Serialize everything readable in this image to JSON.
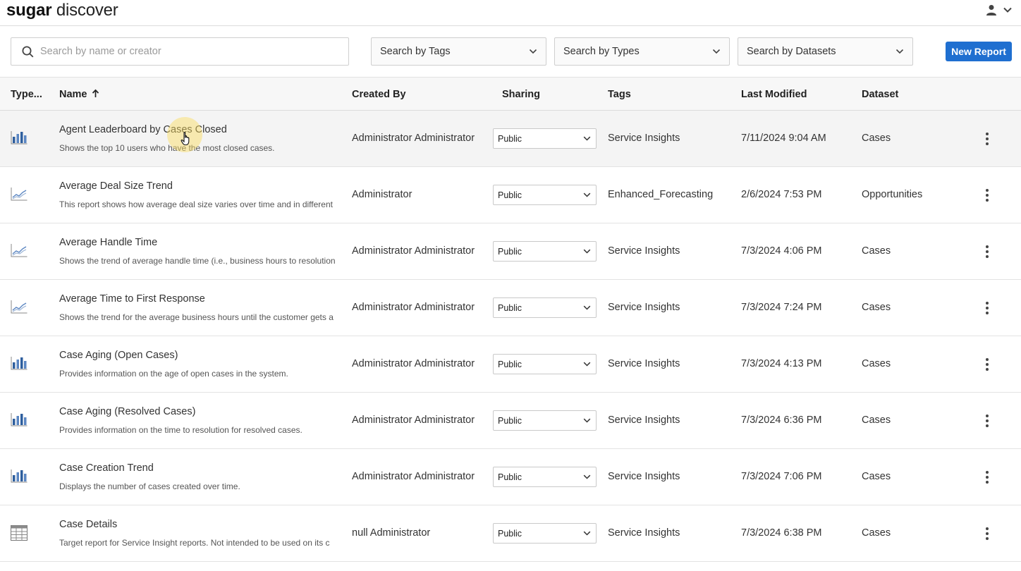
{
  "header": {
    "brand": "sugar",
    "product": "discover",
    "user_icon": "user-icon",
    "menu_icon": "chevron-down-icon"
  },
  "filters": {
    "search_placeholder": "Search by name or creator",
    "tags_label": "Search by Tags",
    "types_label": "Search by Types",
    "datasets_label": "Search by Datasets",
    "new_report_label": "New Report"
  },
  "colors": {
    "accent": "#1f6fd0",
    "icon": "#2f5f9e"
  },
  "table": {
    "columns": {
      "type": "Type...",
      "name": "Name",
      "created_by": "Created By",
      "sharing": "Sharing",
      "tags": "Tags",
      "last_modified": "Last Modified",
      "dataset": "Dataset"
    },
    "sort": {
      "column": "Name",
      "direction": "ascending"
    },
    "rows": [
      {
        "type_icon": "bar-chart-icon",
        "name": "Agent Leaderboard by Cases Closed",
        "description": "Shows the top 10 users who have the most closed cases.",
        "created_by": "Administrator Administrator",
        "sharing": "Public",
        "tags": "Service Insights",
        "last_modified": "7/11/2024 9:04 AM",
        "dataset": "Cases"
      },
      {
        "type_icon": "line-chart-icon",
        "name": "Average Deal Size Trend",
        "description": "This report shows how average deal size varies over time and in different",
        "created_by": "Administrator",
        "sharing": "Public",
        "tags": "Enhanced_Forecasting",
        "last_modified": "2/6/2024 7:53 PM",
        "dataset": "Opportunities"
      },
      {
        "type_icon": "line-chart-icon",
        "name": "Average Handle Time",
        "description": "Shows the trend of average handle time (i.e., business hours to resolution",
        "created_by": "Administrator Administrator",
        "sharing": "Public",
        "tags": "Service Insights",
        "last_modified": "7/3/2024 4:06 PM",
        "dataset": "Cases"
      },
      {
        "type_icon": "line-chart-icon",
        "name": "Average Time to First Response",
        "description": "Shows the trend for the average business hours until the customer gets a",
        "created_by": "Administrator Administrator",
        "sharing": "Public",
        "tags": "Service Insights",
        "last_modified": "7/3/2024 7:24 PM",
        "dataset": "Cases"
      },
      {
        "type_icon": "bar-chart-icon",
        "name": "Case Aging (Open Cases)",
        "description": "Provides information on the age of open cases in the system.",
        "created_by": "Administrator Administrator",
        "sharing": "Public",
        "tags": "Service Insights",
        "last_modified": "7/3/2024 4:13 PM",
        "dataset": "Cases"
      },
      {
        "type_icon": "bar-chart-icon",
        "name": "Case Aging (Resolved Cases)",
        "description": "Provides information on the time to resolution for resolved cases.",
        "created_by": "Administrator Administrator",
        "sharing": "Public",
        "tags": "Service Insights",
        "last_modified": "7/3/2024 6:36 PM",
        "dataset": "Cases"
      },
      {
        "type_icon": "bar-chart-icon",
        "name": "Case Creation Trend",
        "description": "Displays the number of cases created over time.",
        "created_by": "Administrator Administrator",
        "sharing": "Public",
        "tags": "Service Insights",
        "last_modified": "7/3/2024 7:06 PM",
        "dataset": "Cases"
      },
      {
        "type_icon": "table-grid-icon",
        "name": "Case Details",
        "description": "Target report for Service Insight reports. Not intended to be used on its c",
        "created_by": "null Administrator",
        "sharing": "Public",
        "tags": "Service Insights",
        "last_modified": "7/3/2024 6:38 PM",
        "dataset": "Cases"
      }
    ]
  }
}
